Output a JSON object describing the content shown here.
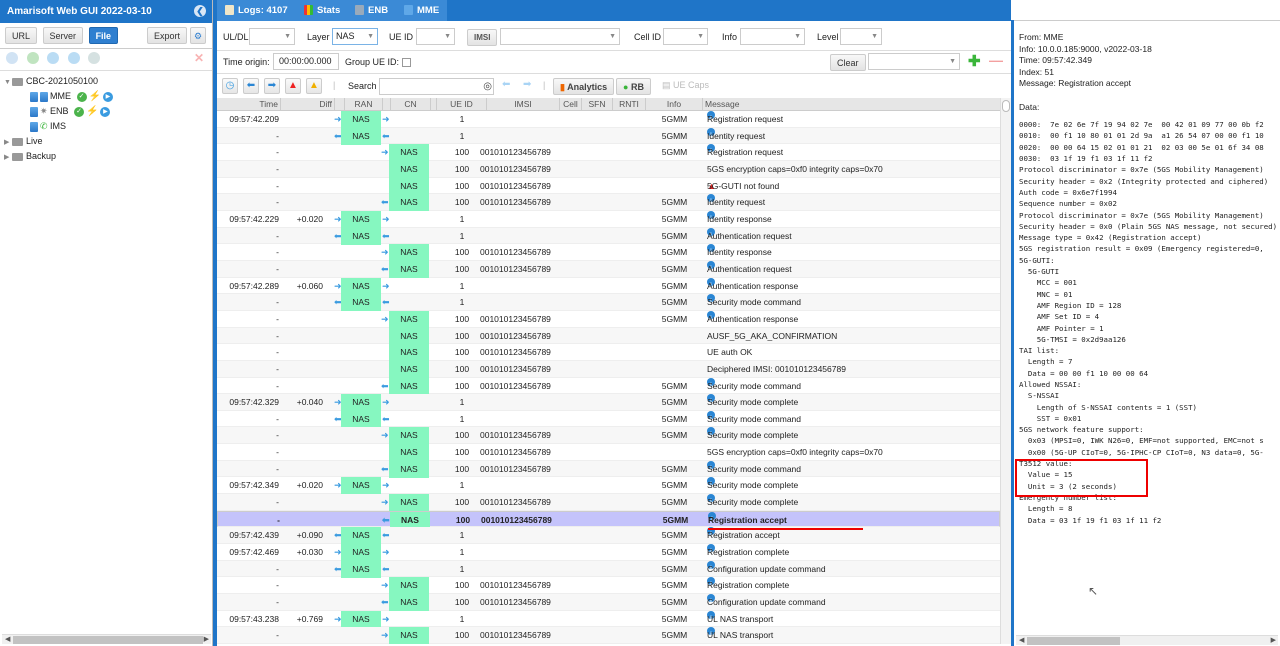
{
  "app": {
    "title": "Amarisoft Web GUI 2022-03-10"
  },
  "left": {
    "buttons": {
      "url": "URL",
      "server": "Server",
      "file": "File",
      "export": "Export"
    },
    "tree": {
      "root": "CBC-2021050100",
      "children": [
        {
          "label": "MME",
          "status": [
            "ok",
            "bolt",
            "play"
          ]
        },
        {
          "label": "ENB",
          "status": [
            "ok",
            "bolt",
            "play"
          ]
        },
        {
          "label": "IMS",
          "status": []
        }
      ],
      "folders": [
        "Live",
        "Backup"
      ]
    }
  },
  "tabs": [
    {
      "label": "Logs: 4107",
      "icon": "document-icon"
    },
    {
      "label": "Stats",
      "icon": "bar-chart-icon"
    },
    {
      "label": "ENB",
      "icon": "antenna-icon"
    },
    {
      "label": "MME",
      "icon": "server-icon"
    }
  ],
  "filters": {
    "uldl_label": "UL/DL",
    "uldl_value": "",
    "layer_label": "Layer",
    "layer_value": "NAS",
    "ueid_label": "UE ID",
    "ueid_value": "",
    "imsi_button": "IMSI",
    "imsi_value": "",
    "cellid_label": "Cell ID",
    "cellid_value": "",
    "info_label": "Info",
    "info_value": "",
    "level_label": "Level",
    "level_value": "",
    "time_origin_label": "Time origin:",
    "time_origin_value": "00:00:00.000",
    "group_ueid_label": "Group UE ID:",
    "clear_button": "Clear",
    "search_label": "Search",
    "search_value": "",
    "analytics_button": "Analytics",
    "rb_button": "RB",
    "uecaps_button": "UE Caps"
  },
  "columns": [
    "Time",
    "Diff",
    "RAN",
    "CN",
    "UE ID",
    "IMSI",
    "Cell",
    "SFN",
    "RNTI",
    "Info",
    "Message"
  ],
  "rows": [
    {
      "time": "09:57:42.209",
      "diff": "",
      "ran": "NAS",
      "cn": "",
      "dir": "ran-in",
      "ueid": "1",
      "imsi": "",
      "info": "5GMM",
      "msg": "Registration request",
      "icon": "info"
    },
    {
      "time": "-",
      "diff": "",
      "ran": "NAS",
      "cn": "",
      "dir": "ran-out",
      "ueid": "1",
      "imsi": "",
      "info": "5GMM",
      "msg": "Identity request",
      "icon": "info"
    },
    {
      "time": "-",
      "diff": "",
      "ran": "",
      "cn": "NAS",
      "dir": "cn-in",
      "ueid": "100",
      "imsi": "001010123456789",
      "info": "5GMM",
      "msg": "Registration request",
      "icon": "info"
    },
    {
      "time": "-",
      "diff": "",
      "ran": "",
      "cn": "NAS",
      "dir": "none",
      "ueid": "100",
      "imsi": "001010123456789",
      "info": "",
      "msg": "5GS encryption caps=0xf0 integrity caps=0x70",
      "icon": ""
    },
    {
      "time": "-",
      "diff": "",
      "ran": "",
      "cn": "NAS",
      "dir": "none",
      "ueid": "100",
      "imsi": "001010123456789",
      "info": "",
      "msg": "5G-GUTI not found",
      "icon": "warn"
    },
    {
      "time": "-",
      "diff": "",
      "ran": "",
      "cn": "NAS",
      "dir": "cn-out",
      "ueid": "100",
      "imsi": "001010123456789",
      "info": "5GMM",
      "msg": "Identity request",
      "icon": "info"
    },
    {
      "time": "09:57:42.229",
      "diff": "+0.020",
      "ran": "NAS",
      "cn": "",
      "dir": "ran-in",
      "ueid": "1",
      "imsi": "",
      "info": "5GMM",
      "msg": "Identity response",
      "icon": "info"
    },
    {
      "time": "-",
      "diff": "",
      "ran": "NAS",
      "cn": "",
      "dir": "ran-out",
      "ueid": "1",
      "imsi": "",
      "info": "5GMM",
      "msg": "Authentication request",
      "icon": "info"
    },
    {
      "time": "-",
      "diff": "",
      "ran": "",
      "cn": "NAS",
      "dir": "cn-in",
      "ueid": "100",
      "imsi": "001010123456789",
      "info": "5GMM",
      "msg": "Identity response",
      "icon": "info"
    },
    {
      "time": "-",
      "diff": "",
      "ran": "",
      "cn": "NAS",
      "dir": "cn-out",
      "ueid": "100",
      "imsi": "001010123456789",
      "info": "5GMM",
      "msg": "Authentication request",
      "icon": "info"
    },
    {
      "time": "09:57:42.289",
      "diff": "+0.060",
      "ran": "NAS",
      "cn": "",
      "dir": "ran-in",
      "ueid": "1",
      "imsi": "",
      "info": "5GMM",
      "msg": "Authentication response",
      "icon": "info"
    },
    {
      "time": "-",
      "diff": "",
      "ran": "NAS",
      "cn": "",
      "dir": "ran-out",
      "ueid": "1",
      "imsi": "",
      "info": "5GMM",
      "msg": "Security mode command",
      "icon": "info"
    },
    {
      "time": "-",
      "diff": "",
      "ran": "",
      "cn": "NAS",
      "dir": "cn-in",
      "ueid": "100",
      "imsi": "001010123456789",
      "info": "5GMM",
      "msg": "Authentication response",
      "icon": "info"
    },
    {
      "time": "-",
      "diff": "",
      "ran": "",
      "cn": "NAS",
      "dir": "none",
      "ueid": "100",
      "imsi": "001010123456789",
      "info": "",
      "msg": "AUSF_5G_AKA_CONFIRMATION",
      "icon": ""
    },
    {
      "time": "-",
      "diff": "",
      "ran": "",
      "cn": "NAS",
      "dir": "none",
      "ueid": "100",
      "imsi": "001010123456789",
      "info": "",
      "msg": "UE auth OK",
      "icon": ""
    },
    {
      "time": "-",
      "diff": "",
      "ran": "",
      "cn": "NAS",
      "dir": "none",
      "ueid": "100",
      "imsi": "001010123456789",
      "info": "",
      "msg": "Deciphered IMSI: 001010123456789",
      "icon": ""
    },
    {
      "time": "-",
      "diff": "",
      "ran": "",
      "cn": "NAS",
      "dir": "cn-out",
      "ueid": "100",
      "imsi": "001010123456789",
      "info": "5GMM",
      "msg": "Security mode command",
      "icon": "info"
    },
    {
      "time": "09:57:42.329",
      "diff": "+0.040",
      "ran": "NAS",
      "cn": "",
      "dir": "ran-in",
      "ueid": "1",
      "imsi": "",
      "info": "5GMM",
      "msg": "Security mode complete",
      "icon": "info"
    },
    {
      "time": "-",
      "diff": "",
      "ran": "NAS",
      "cn": "",
      "dir": "ran-out",
      "ueid": "1",
      "imsi": "",
      "info": "5GMM",
      "msg": "Security mode command",
      "icon": "info"
    },
    {
      "time": "-",
      "diff": "",
      "ran": "",
      "cn": "NAS",
      "dir": "cn-in",
      "ueid": "100",
      "imsi": "001010123456789",
      "info": "5GMM",
      "msg": "Security mode complete",
      "icon": "info"
    },
    {
      "time": "-",
      "diff": "",
      "ran": "",
      "cn": "NAS",
      "dir": "none",
      "ueid": "100",
      "imsi": "001010123456789",
      "info": "",
      "msg": "5GS encryption caps=0xf0 integrity caps=0x70",
      "icon": ""
    },
    {
      "time": "-",
      "diff": "",
      "ran": "",
      "cn": "NAS",
      "dir": "cn-out",
      "ueid": "100",
      "imsi": "001010123456789",
      "info": "5GMM",
      "msg": "Security mode command",
      "icon": "info"
    },
    {
      "time": "09:57:42.349",
      "diff": "+0.020",
      "ran": "NAS",
      "cn": "",
      "dir": "ran-in",
      "ueid": "1",
      "imsi": "",
      "info": "5GMM",
      "msg": "Security mode complete",
      "icon": "info"
    },
    {
      "time": "-",
      "diff": "",
      "ran": "",
      "cn": "NAS",
      "dir": "cn-in",
      "ueid": "100",
      "imsi": "001010123456789",
      "info": "5GMM",
      "msg": "Security mode complete",
      "icon": "info"
    },
    {
      "time": "-",
      "diff": "",
      "ran": "",
      "cn": "NAS",
      "dir": "cn-out",
      "ueid": "100",
      "imsi": "001010123456789",
      "info": "5GMM",
      "msg": "Registration accept",
      "icon": "info",
      "selected": true
    },
    {
      "time": "09:57:42.439",
      "diff": "+0.090",
      "ran": "NAS",
      "cn": "",
      "dir": "ran-out",
      "ueid": "1",
      "imsi": "",
      "info": "5GMM",
      "msg": "Registration accept",
      "icon": "info"
    },
    {
      "time": "09:57:42.469",
      "diff": "+0.030",
      "ran": "NAS",
      "cn": "",
      "dir": "ran-in",
      "ueid": "1",
      "imsi": "",
      "info": "5GMM",
      "msg": "Registration complete",
      "icon": "info"
    },
    {
      "time": "-",
      "diff": "",
      "ran": "NAS",
      "cn": "",
      "dir": "ran-out",
      "ueid": "1",
      "imsi": "",
      "info": "5GMM",
      "msg": "Configuration update command",
      "icon": "info"
    },
    {
      "time": "-",
      "diff": "",
      "ran": "",
      "cn": "NAS",
      "dir": "cn-in",
      "ueid": "100",
      "imsi": "001010123456789",
      "info": "5GMM",
      "msg": "Registration complete",
      "icon": "info"
    },
    {
      "time": "-",
      "diff": "",
      "ran": "",
      "cn": "NAS",
      "dir": "cn-out",
      "ueid": "100",
      "imsi": "001010123456789",
      "info": "5GMM",
      "msg": "Configuration update command",
      "icon": "info"
    },
    {
      "time": "09:57:43.238",
      "diff": "+0.769",
      "ran": "NAS",
      "cn": "",
      "dir": "ran-in",
      "ueid": "1",
      "imsi": "",
      "info": "5GMM",
      "msg": "UL NAS transport",
      "icon": "info"
    },
    {
      "time": "-",
      "diff": "",
      "ran": "",
      "cn": "NAS",
      "dir": "cn-in",
      "ueid": "100",
      "imsi": "001010123456789",
      "info": "5GMM",
      "msg": "UL NAS transport",
      "icon": "info"
    }
  ],
  "detail": {
    "from": "From: MME",
    "info": "Info: 10.0.0.185:9000, v2022-03-18",
    "time": "Time: 09:57:42.349",
    "index": "Index: 51",
    "message": "Message: Registration accept",
    "data_label": "Data:",
    "lines": [
      "0000:  7e 02 6e 7f 19 94 02 7e  00 42 01 09 77 00 0b f2",
      "0010:  00 f1 10 80 01 01 2d 9a  a1 26 54 07 00 00 f1 10",
      "0020:  00 00 64 15 02 01 01 21  02 03 00 5e 01 6f 34 08",
      "0030:  03 1f 19 f1 03 1f 11 f2",
      "Protocol discriminator = 0x7e (5GS Mobility Management)",
      "Security header = 0x2 (Integrity protected and ciphered)",
      "Auth code = 0x6e7f1994",
      "Sequence number = 0x02",
      "Protocol discriminator = 0x7e (5GS Mobility Management)",
      "Security header = 0x0 (Plain 5GS NAS message, not secured)",
      "Message type = 0x42 (Registration accept)",
      "5GS registration result = 0x09 (Emergency registered=0, ",
      "5G-GUTI:",
      "  5G-GUTI",
      "    MCC = 001",
      "    MNC = 01",
      "    AMF Region ID = 128",
      "    AMF Set ID = 4",
      "    AMF Pointer = 1",
      "    5G-TMSI = 0x2d9aa126",
      "TAI list:",
      "  Length = 7",
      "  Data = 00 00 f1 10 00 00 64",
      "Allowed NSSAI:",
      "  S-NSSAI",
      "    Length of S-NSSAI contents = 1 (SST)",
      "    SST = 0x01",
      "5GS network feature support:",
      "  0x03 (MPSI=0, IWK N26=0, EMF=not supported, EMC=not s",
      "  0x00 (5G-UP CIoT=0, 5G-IPHC-CP CIoT=0, N3 data=0, 5G-",
      "T3512 value:",
      "  Value = 15",
      "  Unit = 3 (2 seconds)",
      "Emergency number list:",
      "  Length = 8",
      "  Data = 03 1f 19 f1 03 1f 11 f2"
    ]
  },
  "colors": {
    "accent": "#1f75c8",
    "nas": "#86f7c0",
    "selected_row": "#c4c3fb",
    "annotation": "#e00000"
  }
}
